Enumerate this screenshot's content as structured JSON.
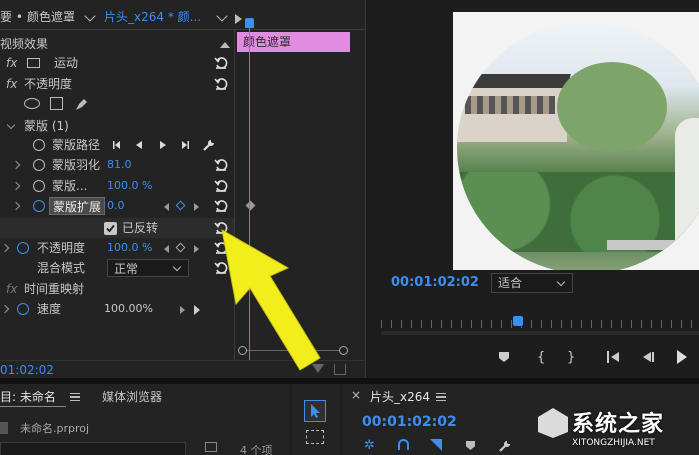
{
  "effect_controls": {
    "header": {
      "source_prefix": "要 •",
      "source_clip": "颜色遮罩",
      "sequence_clip": "片头_x264 * 颜..."
    },
    "section_video_effects": "视频效果",
    "fx_motion": "运动",
    "fx_opacity": "不透明度",
    "mask_group": "蒙版 (1)",
    "mask_path": "蒙版路径",
    "mask_feather_label": "蒙版羽化",
    "mask_feather_value": "81.0",
    "mask_opacity_label": "蒙版...",
    "mask_opacity_value": "100.0 %",
    "mask_expansion_label": "蒙版扩展",
    "mask_expansion_value": "0.0",
    "inverted_label": "已反转",
    "opacity_label": "不透明度",
    "opacity_value": "100.0 %",
    "blend_mode_label": "混合模式",
    "blend_mode_value": "正常",
    "time_remap": "时间重映射",
    "speed_label": "速度",
    "speed_value": "100.00%",
    "timecode": "01:02:02"
  },
  "timeline_clip_label": "颜色遮罩",
  "program_monitor": {
    "timecode": "00:01:02:02",
    "fit_value": "适合"
  },
  "project_panel": {
    "tab_project": "目: 未命名",
    "tab_media_browser": "媒体浏览器",
    "file_name": "未命名.prproj",
    "item_count": "4 个项"
  },
  "timeline_panel": {
    "tab_name": "片头_x264",
    "timecode": "00:01:02:02"
  },
  "watermark": {
    "brand": "系统之家",
    "url": "XITONGZHIJIA.NET"
  },
  "colors": {
    "accent_blue": "#3d8ef0",
    "clip_pink": "#e08ce0",
    "arrow_yellow": "#f2ee1c"
  }
}
